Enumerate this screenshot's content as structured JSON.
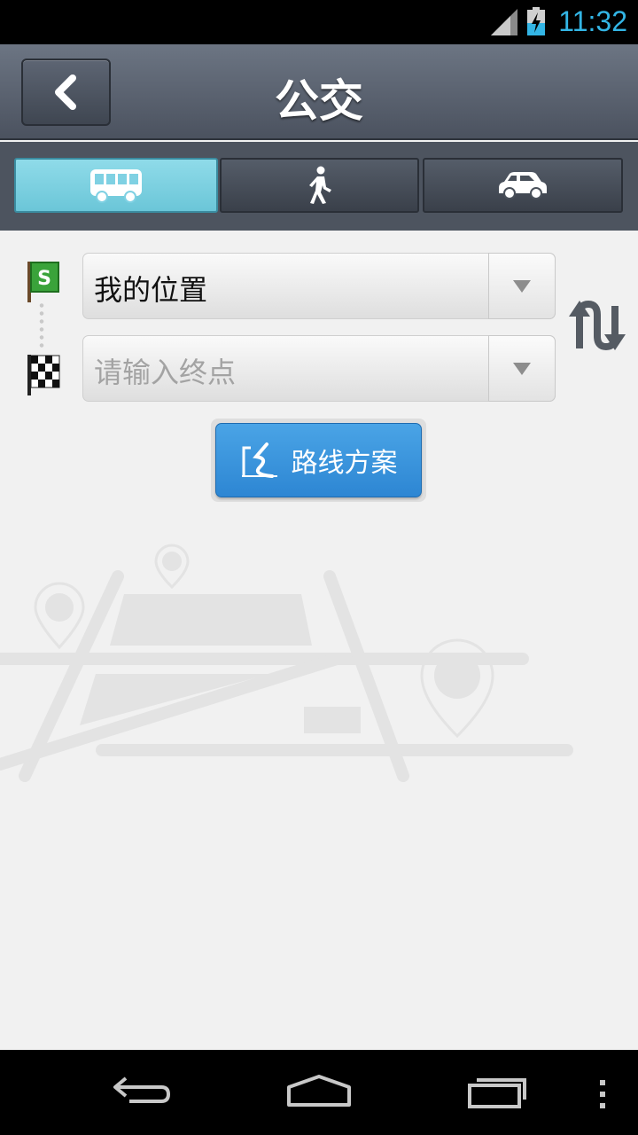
{
  "status_bar": {
    "time": "11:32",
    "icons": [
      "signal-icon",
      "battery-charging-icon"
    ]
  },
  "header": {
    "title": "公交",
    "back_icon": "chevron-left-icon"
  },
  "mode_tabs": [
    {
      "icon": "bus-icon",
      "active": true
    },
    {
      "icon": "walk-icon",
      "active": false
    },
    {
      "icon": "car-icon",
      "active": false
    }
  ],
  "route_form": {
    "start": {
      "value": "我的位置",
      "icon": "start-flag-icon"
    },
    "end": {
      "placeholder": "请输入终点",
      "icon": "finish-flag-icon"
    },
    "swap_icon": "swap-icon"
  },
  "route_button": {
    "label": "路线方案",
    "icon": "route-icon"
  },
  "nav_bar": {
    "icons": [
      "back-icon",
      "home-icon",
      "recents-icon",
      "menu-icon"
    ]
  },
  "colors": {
    "accent_blue": "#33b5e5",
    "active_tab": "#7fd1e3",
    "button_blue": "#3593dc"
  }
}
